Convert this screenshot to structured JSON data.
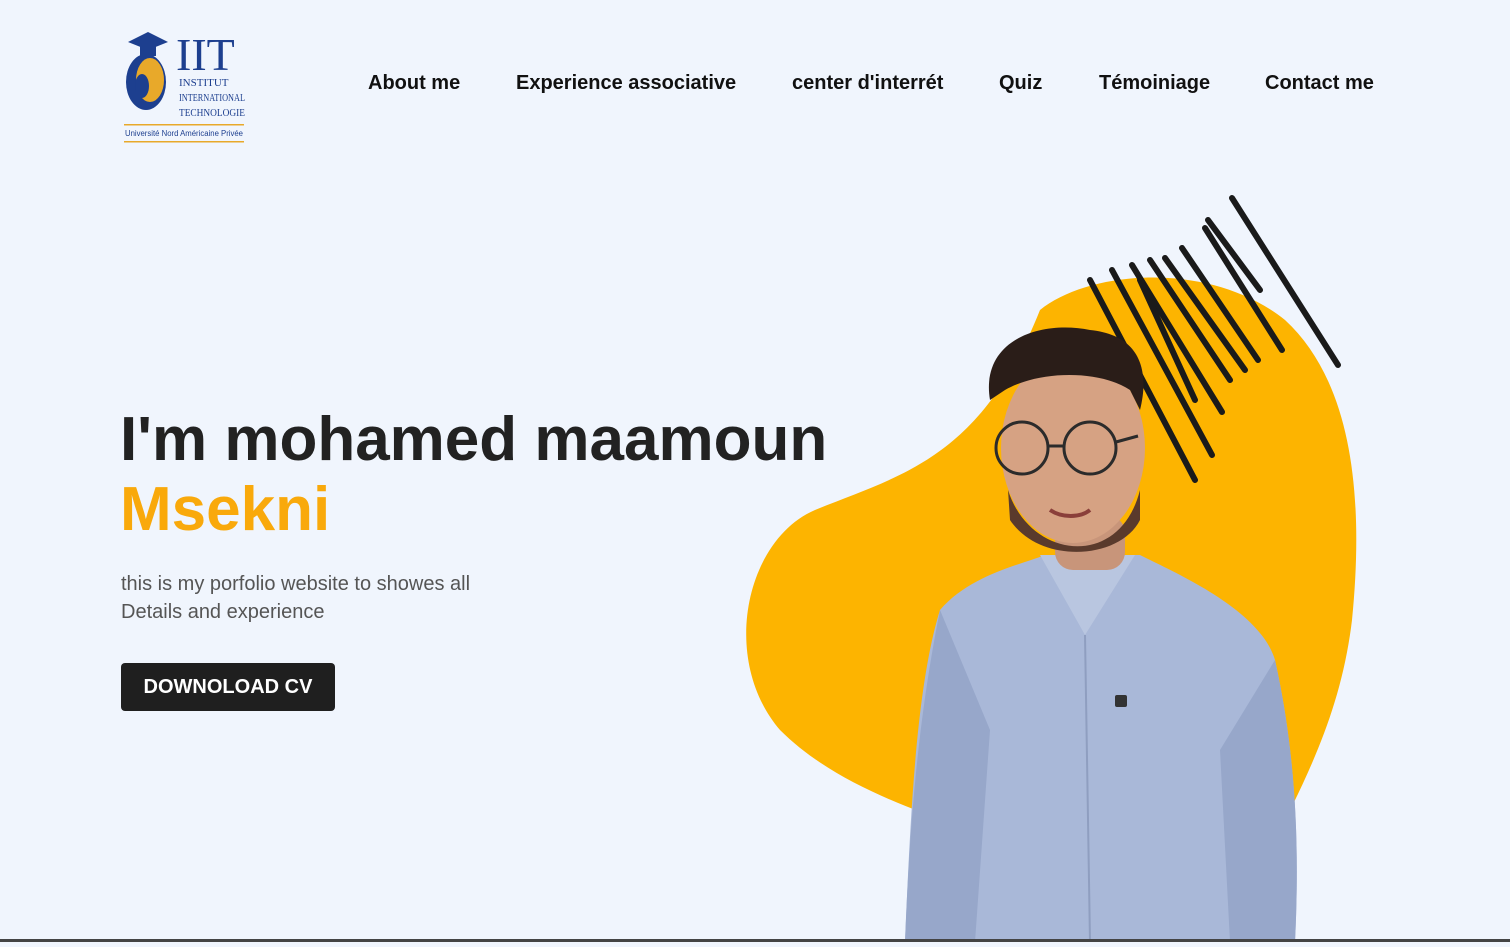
{
  "logo": {
    "letters": "IIT",
    "line1": "INSTITUT",
    "line2": "INTERNATIONAL",
    "line3": "TECHNOLOGIE",
    "tagline": "Université Nord Américaine Privée"
  },
  "nav": {
    "items": [
      {
        "label": "About me"
      },
      {
        "label": "Experience associative"
      },
      {
        "label": "center d'interrét"
      },
      {
        "label": "Quiz"
      },
      {
        "label": "Témoiniage"
      },
      {
        "label": "Contact me"
      }
    ]
  },
  "hero": {
    "title": "I'm mohamed maamoun",
    "name": "Msekni",
    "desc_line1": "this is my porfolio website to showes all",
    "desc_line2": "Details and experience",
    "button_label": "DOWNOLOAD CV"
  },
  "colors": {
    "accent": "#f9a90b",
    "background": "#f0f5fd",
    "button": "#1f1f1f",
    "text": "#222222"
  }
}
